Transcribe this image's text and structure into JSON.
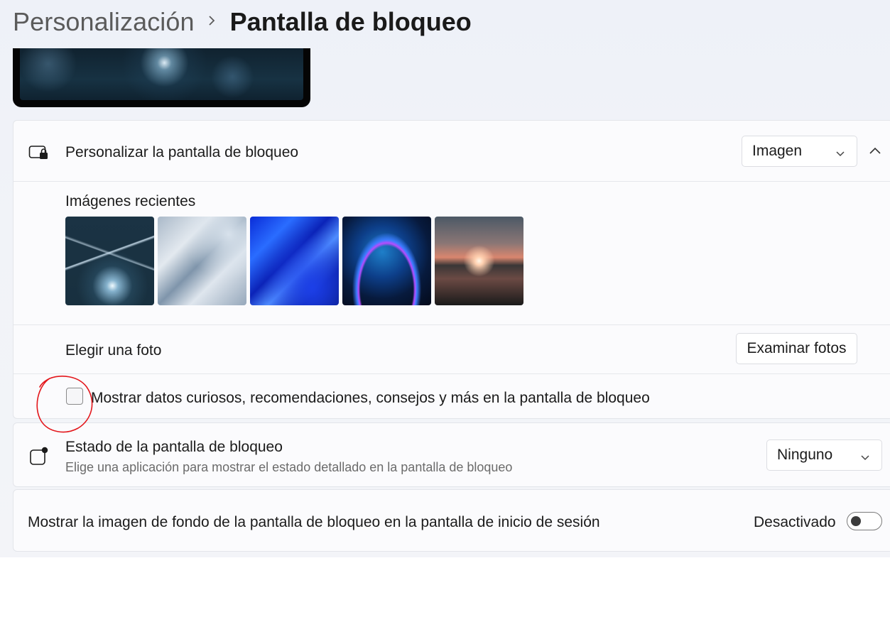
{
  "header": {
    "breadcrumb_parent": "Personalización",
    "breadcrumb_current": "Pantalla de bloqueo"
  },
  "personalize": {
    "label": "Personalizar la pantalla de bloqueo",
    "dropdown_value": "Imagen",
    "icon": "monitor-lock-icon"
  },
  "recent": {
    "label": "Imágenes recientes",
    "count": 5
  },
  "choose_photo": {
    "label": "Elegir una foto",
    "button_label": "Examinar fotos"
  },
  "fun_facts": {
    "label": "Mostrar datos curiosos, recomendaciones, consejos y más en la pantalla de bloqueo",
    "checked": false
  },
  "status": {
    "label": "Estado de la pantalla de bloqueo",
    "sublabel": "Elige una aplicación para mostrar el estado detallado en la pantalla de bloqueo",
    "dropdown_value": "Ninguno",
    "icon": "status-badge-icon"
  },
  "signin_bg": {
    "label": "Mostrar la imagen de fondo de la pantalla de bloqueo en la pantalla de inicio de sesión",
    "toggle_label": "Desactivado",
    "toggle_on": false
  },
  "colors": {
    "annotation": "#e3161b"
  }
}
